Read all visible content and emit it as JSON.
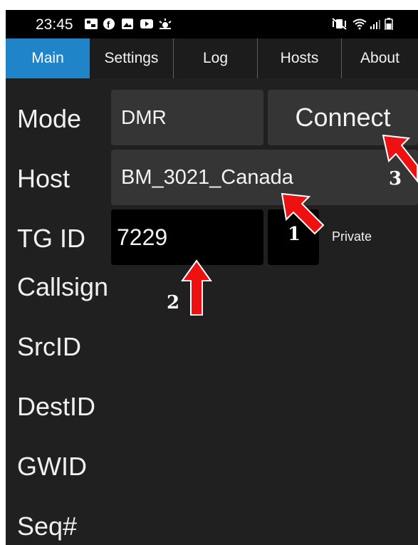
{
  "status_bar": {
    "time": "23:45"
  },
  "tabs": [
    {
      "label": "Main"
    },
    {
      "label": "Settings"
    },
    {
      "label": "Log"
    },
    {
      "label": "Hosts"
    },
    {
      "label": "About"
    }
  ],
  "main": {
    "mode_label": "Mode",
    "mode_value": "DMR",
    "connect_label": "Connect",
    "host_label": "Host",
    "host_value": "BM_3021_Canada",
    "tg_label": "TG ID",
    "tg_value": "7229",
    "private_label": "Private",
    "callsign_label": "Callsign",
    "srcid_label": "SrcID",
    "destid_label": "DestID",
    "gwid_label": "GWID",
    "seq_label": "Seq#"
  },
  "annotations": [
    {
      "number": "1"
    },
    {
      "number": "2"
    },
    {
      "number": "3"
    }
  ],
  "colors": {
    "active_tab": "#1f84c8",
    "background": "#202020",
    "arrow": "#ee1111"
  }
}
